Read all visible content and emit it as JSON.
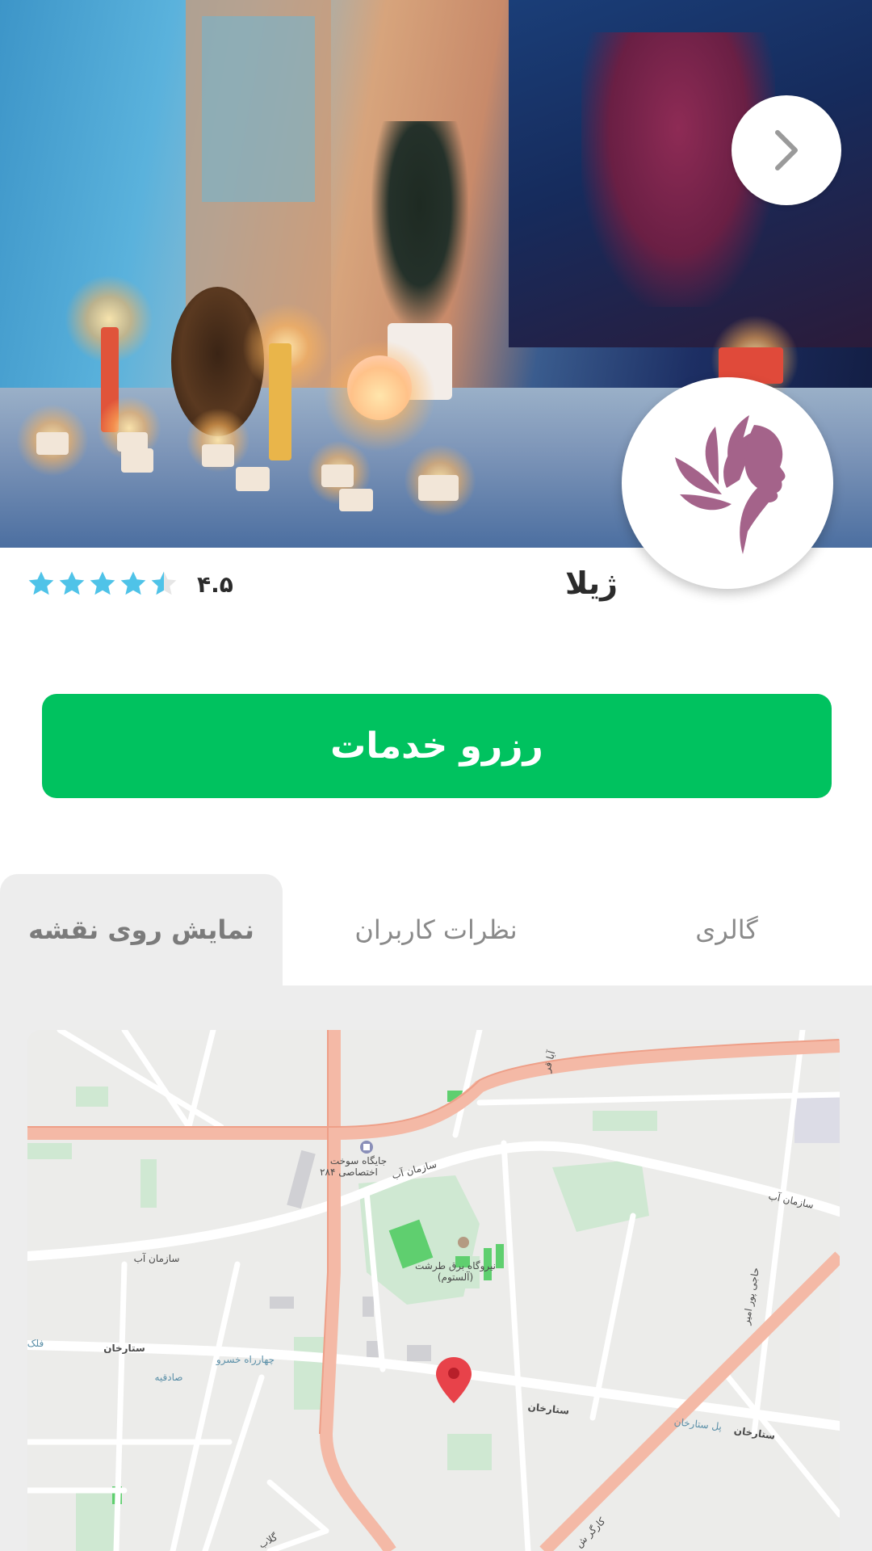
{
  "salon": {
    "name": "ژیلا",
    "rating_value": "۴.۵",
    "rating": 4.5,
    "rating_max": 5
  },
  "booking": {
    "label": "رزرو خدمات"
  },
  "tabs": [
    {
      "label": "گالری",
      "active": false
    },
    {
      "label": "نظرات کاربران",
      "active": false
    },
    {
      "label": "نمایش روی نقشه",
      "active": true
    }
  ],
  "colors": {
    "primary_green": "#00c25f",
    "star": "#4fc3e8",
    "logo": "#a4638a"
  },
  "icons": {
    "next": "chevron-right-icon",
    "logo": "woman-leaf-logo",
    "pin": "map-pin-icon"
  },
  "map": {
    "labels": {
      "gas_station": "جایگاه سوخت",
      "gas_station_2": "اختصاصی ۲۸۴",
      "power_plant": "نیروگاه برق طرشت",
      "power_plant_2": "(آلستوم)",
      "water_org_1": "سازمان آب",
      "water_org_2": "سازمان آب",
      "water_org_3": "سازمان آب",
      "sattarkhan_1": "ستارخان",
      "sattarkhan_2": "ستارخان",
      "sattarkhan_3": "ستارخان",
      "chaharrah_khosro": "چهارراه خسرو",
      "sadeghieh": "صادقیه",
      "pol_sattarkhan": "پل ستارخان",
      "haji_pour_amir": "حاجی پور امیر",
      "kargar": "کارگر ش",
      "golab": "گلاب",
      "falak": "فلک",
      "ayat": "آیا قر"
    }
  }
}
